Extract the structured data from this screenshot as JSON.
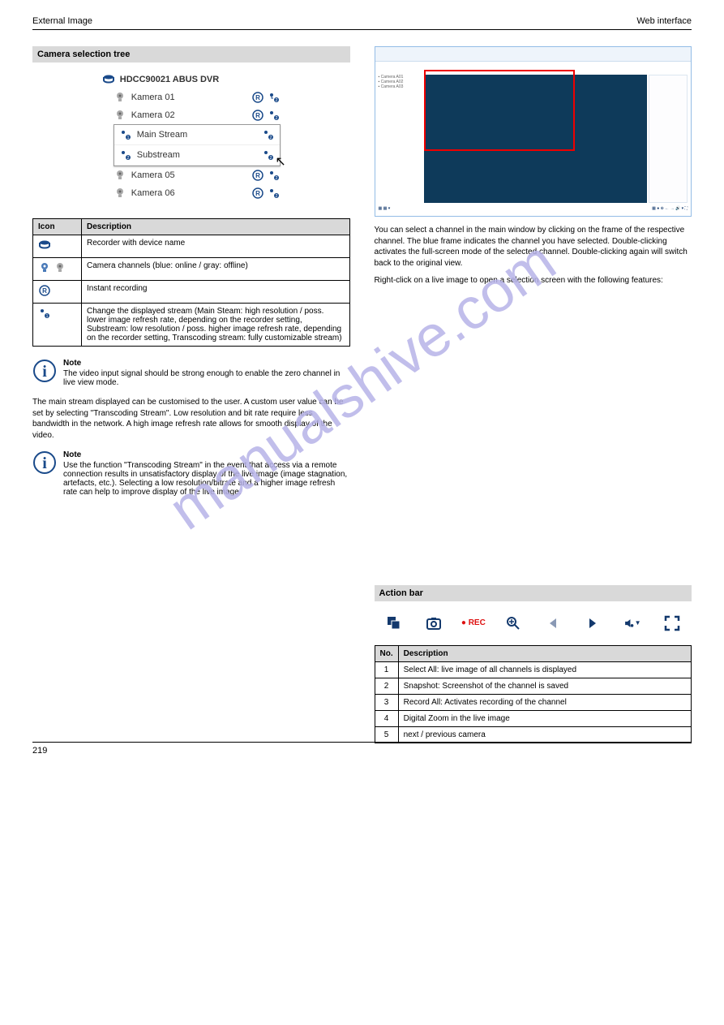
{
  "hdr_left": "External Image",
  "hdr_right": "Web interface",
  "ftr_left": "219",
  "watermark": "manualshive.com",
  "left": {
    "bar": "Camera selection tree",
    "tree": {
      "root": "HDCC90021 ABUS DVR",
      "items": [
        {
          "label": "Kamera 01"
        },
        {
          "label": "Kamera 02"
        },
        {
          "label": "Main Stream",
          "sub": true,
          "stream": 1
        },
        {
          "label": "Substream",
          "sub": true,
          "stream": 2
        },
        {
          "label": "Kamera 05"
        },
        {
          "label": "Kamera 06"
        }
      ]
    },
    "tbl": {
      "head": [
        "Icon",
        "Description"
      ],
      "rows": [
        [
          "rec",
          "Recorder with device name"
        ],
        [
          "cam",
          "Camera channels (blue: online / gray: offline)"
        ],
        [
          "r",
          "Instant recording"
        ],
        [
          "sw",
          "Change the displayed stream (Main Steam: high resolution / poss. lower image refresh rate, depending on the recorder setting, Substream: low resolution / poss. higher image refresh rate, depending on the recorder setting, Transcoding stream: fully customizable stream)"
        ]
      ]
    },
    "note1": {
      "title": "Note",
      "body": "The video input signal should be strong enough to enable the zero channel in live view mode."
    },
    "p1": "The main stream displayed can be customised to the user. A custom user value can be set by selecting \"Transcoding Stream\". Low resolution and bit rate require less bandwidth in the network. A high image refresh rate allows for smooth display of the video.",
    "note2": {
      "title": "Note",
      "body": "Use the function \"Transcoding Stream\" in the event that access via a remote connection results in unsatisfactory display of the live image (image stagnation, artefacts, etc.). Selecting a low resolution/bitrate and a higher image refresh rate can help to improve display of the live image."
    }
  },
  "right": {
    "p1": "You can select a channel in the main window by clicking on the frame of the respective channel. The blue frame indicates the channel you have selected. Double-clicking activates the full-screen mode of the selected channel. Double-clicking again will switch back to the original view.",
    "p2": "Right-click on a live image to open a selection screen with the following features:",
    "bar": "Action bar",
    "tbl": {
      "head": [
        "No.",
        "Description"
      ],
      "rows": [
        [
          "1",
          "Select All: live image of all channels is displayed"
        ],
        [
          "2",
          "Snapshot: Screenshot of the channel is saved"
        ],
        [
          "3",
          "Record All: Activates recording of the channel"
        ],
        [
          "4",
          "Digital Zoom in the live image"
        ],
        [
          "5",
          "next / previous camera"
        ]
      ]
    }
  }
}
